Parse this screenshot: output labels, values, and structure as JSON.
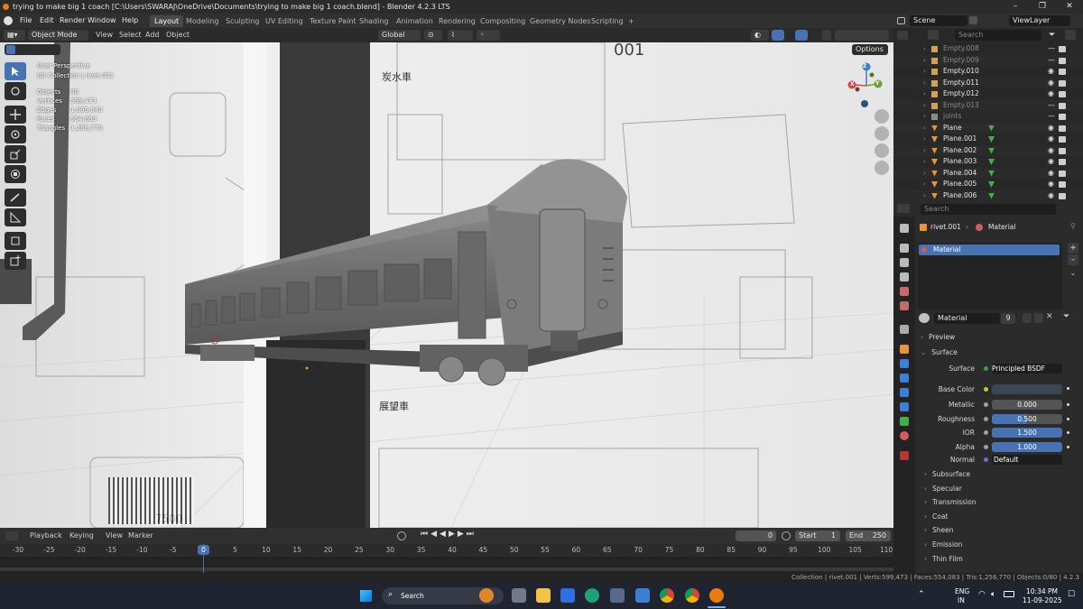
{
  "window": {
    "title": "trying to make big 1 coach [C:\\Users\\SWARAJ\\OneDrive\\Documents\\trying to make big 1 coach.blend] - Blender 4.2.3 LTS",
    "min": "–",
    "max": "❐",
    "close": "✕"
  },
  "menu": [
    "File",
    "Edit",
    "Render",
    "Window",
    "Help"
  ],
  "workspaces": [
    "Layout",
    "Modeling",
    "Sculpting",
    "UV Editing",
    "Texture Paint",
    "Shading",
    "Animation",
    "Rendering",
    "Compositing",
    "Geometry Nodes",
    "Scripting"
  ],
  "active_workspace": "Layout",
  "add_tab": "+",
  "scene": {
    "label": "Scene",
    "viewlayer": "ViewLayer"
  },
  "viewport": {
    "mode": "Object Mode",
    "menus": [
      "View",
      "Select",
      "Add",
      "Object"
    ],
    "transform": "Global",
    "options": "Options",
    "overlay_info": {
      "perspective": "User Perspective",
      "collection": "(0) Collection | rivet.001",
      "rows": [
        {
          "label": "Objects",
          "value": "80"
        },
        {
          "label": "Vertices",
          "value": "599,473"
        },
        {
          "label": "Edges",
          "value": "1,095,640"
        },
        {
          "label": "Faces",
          "value": "554,083"
        },
        {
          "label": "Triangles",
          "value": "1,256,770"
        }
      ]
    },
    "gizmo": {
      "x": "X",
      "y": "Y",
      "z": "Z"
    },
    "image_text": {
      "top_label": "炭水車",
      "mid_label": "展望車",
      "bottom_number": "7500",
      "plate": "001"
    }
  },
  "outliner": {
    "search_placeholder": "Search",
    "rows": [
      {
        "name": "Empty.008",
        "type": "empty",
        "visible": false
      },
      {
        "name": "Empty.009",
        "type": "empty",
        "visible": false
      },
      {
        "name": "Empty.010",
        "type": "empty",
        "visible": true
      },
      {
        "name": "Empty.011",
        "type": "empty",
        "visible": true
      },
      {
        "name": "Empty.012",
        "type": "empty",
        "visible": true
      },
      {
        "name": "Empty.013",
        "type": "empty",
        "visible": false
      },
      {
        "name": "joints",
        "type": "armature",
        "visible": false
      },
      {
        "name": "Plane",
        "type": "mesh",
        "visible": true
      },
      {
        "name": "Plane.001",
        "type": "mesh",
        "visible": true
      },
      {
        "name": "Plane.002",
        "type": "mesh",
        "visible": true
      },
      {
        "name": "Plane.003",
        "type": "mesh",
        "visible": true
      },
      {
        "name": "Plane.004",
        "type": "mesh",
        "visible": true
      },
      {
        "name": "Plane.005",
        "type": "mesh",
        "visible": true
      },
      {
        "name": "Plane.006",
        "type": "mesh",
        "visible": true
      }
    ]
  },
  "properties": {
    "search_placeholder": "Search",
    "breadcrumb_object": "rivet.001",
    "breadcrumb_material": "Material",
    "slot_name": "Material",
    "material_name": "Material",
    "user_count": "9",
    "sections": {
      "preview": "Preview",
      "surface": "Surface",
      "collapsed": [
        "Subsurface",
        "Specular",
        "Transmission",
        "Coat",
        "Sheen",
        "Emission",
        "Thin Film"
      ]
    },
    "surface_label": "Surface",
    "surface_value": "Principled BSDF",
    "base_color_label": "Base Color",
    "fields": [
      {
        "label": "Metallic",
        "value": "0.000",
        "fill": 0.0
      },
      {
        "label": "Roughness",
        "value": "0.500",
        "fill": 0.5
      },
      {
        "label": "IOR",
        "value": "1.500",
        "fill": 1.0
      },
      {
        "label": "Alpha",
        "value": "1.000",
        "fill": 1.0
      }
    ],
    "normal_label": "Normal",
    "normal_value": "Default"
  },
  "timeline": {
    "menus": [
      "Playback",
      "Keying",
      "View",
      "Marker"
    ],
    "current_frame": "0",
    "start_label": "Start",
    "start": "1",
    "end_label": "End",
    "end": "250",
    "ticks": [
      "-30",
      "-25",
      "-20",
      "-15",
      "-10",
      "-5",
      "0",
      "5",
      "10",
      "15",
      "20",
      "25",
      "30",
      "35",
      "40",
      "45",
      "50",
      "55",
      "60",
      "65",
      "70",
      "75",
      "80",
      "85",
      "90",
      "95",
      "100",
      "105",
      "110"
    ],
    "playhead": "0"
  },
  "statusbar": {
    "text": "Collection | rivet.001 | Verts:599,473 | Faces:554,083 | Tris:1,256,770 | Objects:0/80 | 4.2.3"
  },
  "taskbar": {
    "search": "Search",
    "lang1": "ENG",
    "lang2": "IN",
    "time": "10:34 PM",
    "date": "11-09-2025"
  }
}
